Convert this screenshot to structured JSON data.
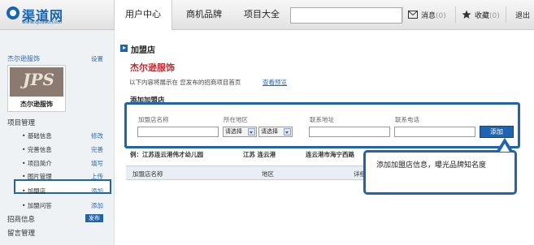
{
  "header": {
    "logo_name": "渠道网",
    "logo_url": "www.qudao.com",
    "nav": [
      "用户中心",
      "商机品牌",
      "项目大全"
    ],
    "search_placeholder": "",
    "messages_label": "消息",
    "messages_count": "(0)",
    "favorites_label": "收藏",
    "favorites_count": "(0)",
    "logout_label": "退出"
  },
  "sidebar": {
    "brand_name": "杰尔逊服饰",
    "settings_label": "设置",
    "brand_image_mark": "JPS",
    "brand_image_text": "杰尔逊服饰",
    "project_mgmt": "项目管理",
    "items": [
      {
        "label": "基础信息",
        "action": "修改"
      },
      {
        "label": "完善信息",
        "action": "完善"
      },
      {
        "label": "项目简介",
        "action": "填写"
      },
      {
        "label": "图片管理",
        "action": "上传"
      },
      {
        "label": "加盟店",
        "action": "添加"
      },
      {
        "label": "加盟问答",
        "action": "添加"
      }
    ],
    "recruit_info": "招商信息",
    "publish_badge": "发布",
    "message_mgmt": "留言管理"
  },
  "main": {
    "page_title": "加盟店",
    "brand_title": "杰尔逊服饰",
    "intro_text": "以下内容将展示在 您发布的招商项目首页",
    "preview_link": "查看预览",
    "section_title": "添加加盟店",
    "form": {
      "name_label": "加盟店名称",
      "region_label": "所在地区",
      "province_select": "请选择",
      "city_select": "请选择",
      "address_label": "联系地址",
      "phone_label": "联系电话",
      "add_button": "添加"
    },
    "example": {
      "name": "例：江苏连云港伟才幼儿园",
      "region": "江苏 连云港",
      "address": "连云港市海宁西路"
    },
    "table_headers": [
      "加盟店名称",
      "地区",
      "详细"
    ]
  },
  "tooltip": {
    "text": "添加加盟店信息，曝光品牌知名度"
  },
  "colors": {
    "accent": "#1f64b0",
    "brand_red": "#c0282d",
    "link": "#2a6bb5"
  }
}
